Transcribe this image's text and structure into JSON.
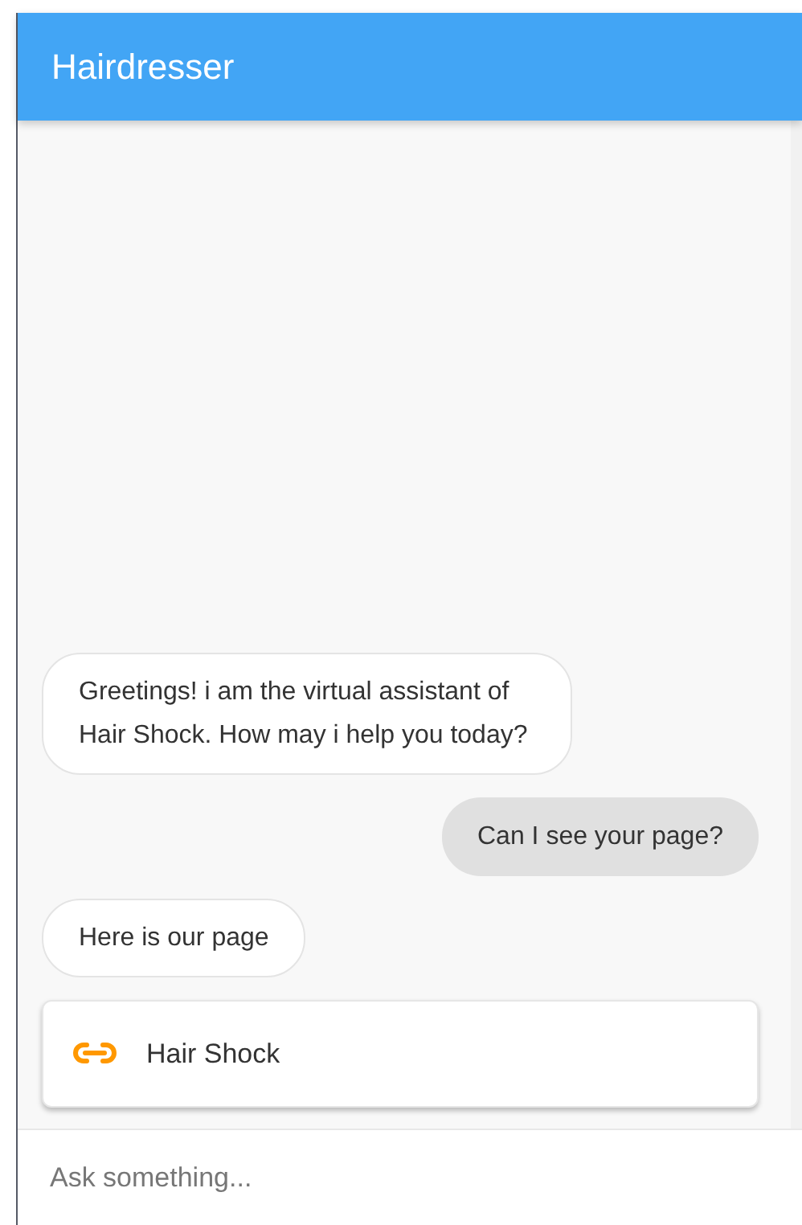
{
  "header": {
    "title": "Hairdresser"
  },
  "messages": [
    {
      "kind": "bot",
      "text": "Greetings! i am the virtual assistant of Hair Shock. How may i help you today?"
    },
    {
      "kind": "user",
      "text": "Can I see your page?"
    },
    {
      "kind": "bot",
      "text": "Here is our page"
    },
    {
      "kind": "link",
      "text": "Hair Shock"
    }
  ],
  "input": {
    "placeholder": "Ask something..."
  }
}
